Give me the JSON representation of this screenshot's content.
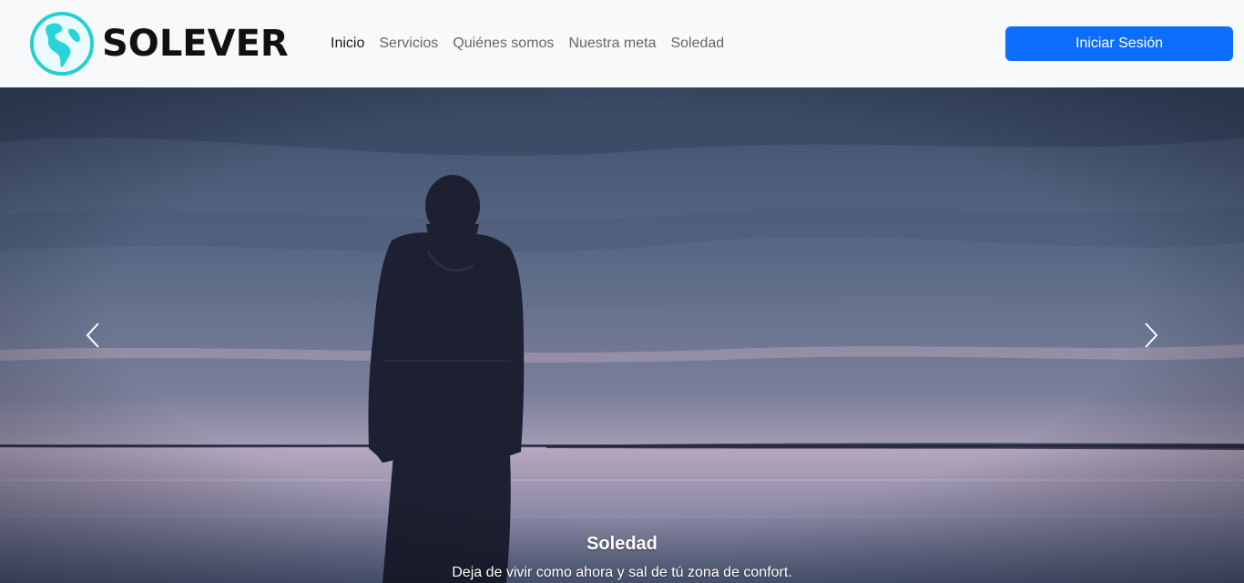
{
  "navbar": {
    "brand": {
      "name": "SOLEVER",
      "logo_icon": "globe-americas-icon",
      "logo_color": "#2ad3d8"
    },
    "links": [
      {
        "label": "Inicio",
        "active": true
      },
      {
        "label": "Servicios",
        "active": false
      },
      {
        "label": "Quiénes somos",
        "active": false
      },
      {
        "label": "Nuestra meta",
        "active": false
      },
      {
        "label": "Soledad",
        "active": false
      }
    ],
    "login_button": "Iniciar Sesión",
    "accent_color": "#0d6efd"
  },
  "carousel": {
    "slide": {
      "title": "Soledad",
      "text": "Deja de vivir como ahora y sal de tú zona de confort."
    },
    "controls": {
      "prev_icon": "chevron-left-icon",
      "next_icon": "chevron-right-icon"
    }
  }
}
